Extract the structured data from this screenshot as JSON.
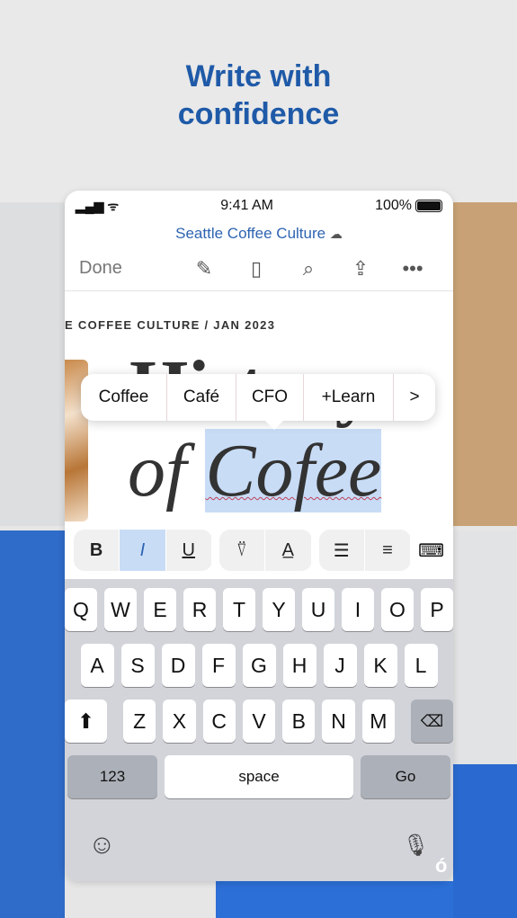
{
  "headline": {
    "line1": "Write with",
    "line2": "confidence"
  },
  "status": {
    "time": "9:41 AM",
    "battery": "100%"
  },
  "doc": {
    "title": "Seattle Coffee Culture",
    "done": "Done",
    "breadcrumb": "E COFFEE CULTURE /  JAN 2023",
    "heading_line1": "History",
    "heading_of": "of",
    "heading_word": "Cofee"
  },
  "suggestions": [
    "Coffee",
    "Café",
    "CFO",
    "+Learn",
    ">"
  ],
  "format": {
    "bold": "B",
    "italic": "I",
    "underline": "U"
  },
  "keyboard": {
    "row1": [
      "Q",
      "W",
      "E",
      "R",
      "T",
      "Y",
      "U",
      "I",
      "O",
      "P"
    ],
    "row2": [
      "A",
      "S",
      "D",
      "F",
      "G",
      "H",
      "J",
      "K",
      "L"
    ],
    "row3": [
      "Z",
      "X",
      "C",
      "V",
      "B",
      "N",
      "M"
    ],
    "numbers": "123",
    "space": "space",
    "go": "Go"
  },
  "watermark": "سیب‌اپ"
}
